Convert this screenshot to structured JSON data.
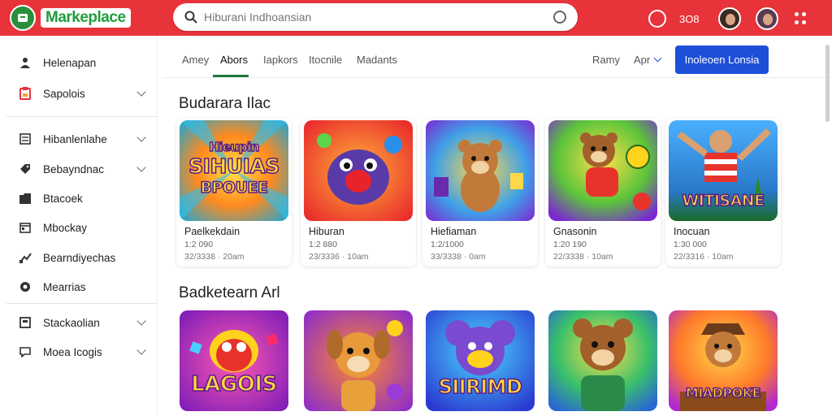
{
  "header": {
    "logo_text": "Markeplace",
    "search_placeholder": "Hiburani Indhoansian",
    "count": "3O8"
  },
  "sidebar": {
    "items": [
      {
        "label": "Helenapan",
        "icon": "user-icon",
        "chevron": false
      },
      {
        "label": "Sapolois",
        "icon": "clipboard-icon",
        "chevron": true
      },
      {
        "label": "Hibanlenlahe",
        "icon": "list-icon",
        "chevron": true
      },
      {
        "label": "Bebayndnac",
        "icon": "tag-icon",
        "chevron": true
      },
      {
        "label": "Btacoek",
        "icon": "folder-icon",
        "chevron": false
      },
      {
        "label": "Mbockay",
        "icon": "calendar-icon",
        "chevron": false
      },
      {
        "label": "Bearndiyechas",
        "icon": "trending-icon",
        "chevron": false
      },
      {
        "label": "Mearrias",
        "icon": "record-icon",
        "chevron": false
      },
      {
        "label": "Stackaolian",
        "icon": "box-icon",
        "chevron": true
      },
      {
        "label": "Moea Icogis",
        "icon": "chat-icon",
        "chevron": true
      }
    ]
  },
  "tabs": [
    "Amey",
    "Abors",
    "Iapkors",
    "Itocnile",
    "Madants"
  ],
  "active_tab": "Abors",
  "sort_label": "Ramy",
  "filter_label": "Apr",
  "cta_label": "Inoleoen Lonsia",
  "sections": [
    {
      "title": "Budarara Ilac",
      "cards": [
        {
          "thumb_text": [
            "Hieupin",
            "SIHUIAS",
            "BPOUEE"
          ],
          "title": "Paelkekdain",
          "sub1": "1:2 090",
          "sub2": "32/3338 · 20am"
        },
        {
          "thumb_text": [],
          "title": "Hiburan",
          "sub1": "1:2 880",
          "sub2": "23/3336 · 10am"
        },
        {
          "thumb_text": [],
          "title": "Hiefiaman",
          "sub1": "1:2/1000",
          "sub2": "33/3338 · 0am"
        },
        {
          "thumb_text": [],
          "title": "Gnasonin",
          "sub1": "1:20 190",
          "sub2": "22/3338 · 10am"
        },
        {
          "thumb_text": [
            "WITISANE"
          ],
          "title": "Inocuan",
          "sub1": "1:30 000",
          "sub2": "22/3316 · 10am"
        }
      ]
    },
    {
      "title": "Badketearn Arl",
      "cards": [
        {
          "thumb_text": [
            "LAGOIS"
          ]
        },
        {
          "thumb_text": []
        },
        {
          "thumb_text": [
            "SIIRIMD"
          ]
        },
        {
          "thumb_text": []
        },
        {
          "thumb_text": [
            "MIADPOKE"
          ]
        }
      ]
    }
  ],
  "colors": {
    "topbar": "#e8333b",
    "accent_blue": "#1d4fd8",
    "tab_underline": "#1f7a3d"
  }
}
